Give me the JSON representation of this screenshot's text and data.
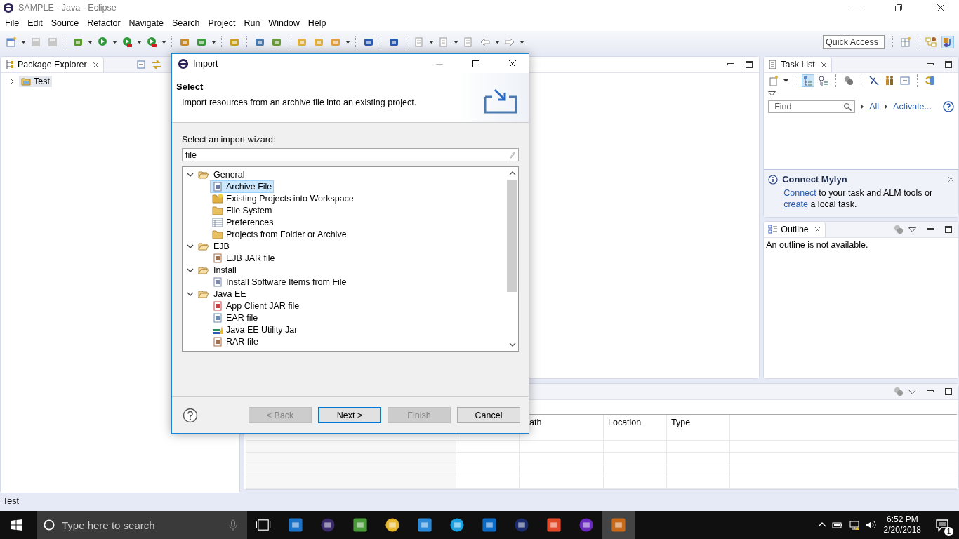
{
  "window": {
    "title": "SAMPLE - Java - Eclipse"
  },
  "menu": [
    "File",
    "Edit",
    "Source",
    "Refactor",
    "Navigate",
    "Search",
    "Project",
    "Run",
    "Window",
    "Help"
  ],
  "quick_access": {
    "placeholder": "Quick Access"
  },
  "package_explorer": {
    "tab": "Package Explorer",
    "tree": [
      {
        "label": "Test",
        "expanded": false
      }
    ]
  },
  "task_list": {
    "tab": "Task List",
    "find": {
      "placeholder": "Find"
    },
    "links": [
      "All",
      "Activate..."
    ],
    "mylyn": {
      "title": "Connect Mylyn",
      "message": [
        {
          "kind": "link",
          "text": "Connect"
        },
        {
          "kind": "text",
          "text": " to your task and ALM tools or "
        },
        {
          "kind": "link",
          "text": "create"
        },
        {
          "kind": "text",
          "text": " a local task."
        }
      ]
    }
  },
  "outline": {
    "tab": "Outline",
    "message": "An outline is not available."
  },
  "bottom_panel": {
    "columns": [
      "ath",
      "Location",
      "Type"
    ]
  },
  "status_bar": "Test",
  "dialog": {
    "title": "Import",
    "heading": "Select",
    "description": "Import resources from an archive file into an existing project.",
    "filter_label": "Select an import wizard:",
    "filter_value": "file",
    "tree": [
      {
        "label": "General",
        "expanded": true,
        "children": [
          {
            "label": "Archive File",
            "kind": "archive",
            "selected": true
          },
          {
            "label": "Existing Projects into Workspace",
            "kind": "project",
            "selected": false
          },
          {
            "label": "File System",
            "kind": "folder",
            "selected": false
          },
          {
            "label": "Preferences",
            "kind": "table",
            "selected": false
          },
          {
            "label": "Projects from Folder or Archive",
            "kind": "folder",
            "selected": false
          }
        ]
      },
      {
        "label": "EJB",
        "expanded": true,
        "children": [
          {
            "label": "EJB JAR file",
            "kind": "jar",
            "selected": false
          }
        ]
      },
      {
        "label": "Install",
        "expanded": true,
        "children": [
          {
            "label": "Install Software Items from File",
            "kind": "install",
            "selected": false
          }
        ]
      },
      {
        "label": "Java EE",
        "expanded": true,
        "children": [
          {
            "label": "App Client JAR file",
            "kind": "app",
            "selected": false
          },
          {
            "label": "EAR file",
            "kind": "ear",
            "selected": false
          },
          {
            "label": "Java EE Utility Jar",
            "kind": "books",
            "selected": false
          },
          {
            "label": "RAR file",
            "kind": "jar",
            "selected": false
          }
        ]
      }
    ],
    "buttons": [
      {
        "label": "< Back",
        "disabled": true,
        "default": false
      },
      {
        "label": "Next >",
        "disabled": false,
        "default": true
      },
      {
        "label": "Finish",
        "disabled": true,
        "default": false
      },
      {
        "label": "Cancel",
        "disabled": false,
        "default": false
      }
    ]
  },
  "taskbar": {
    "search_placeholder": "Type here to search",
    "time": "6:52 PM",
    "date": "2/20/2018",
    "notifications": "1"
  }
}
